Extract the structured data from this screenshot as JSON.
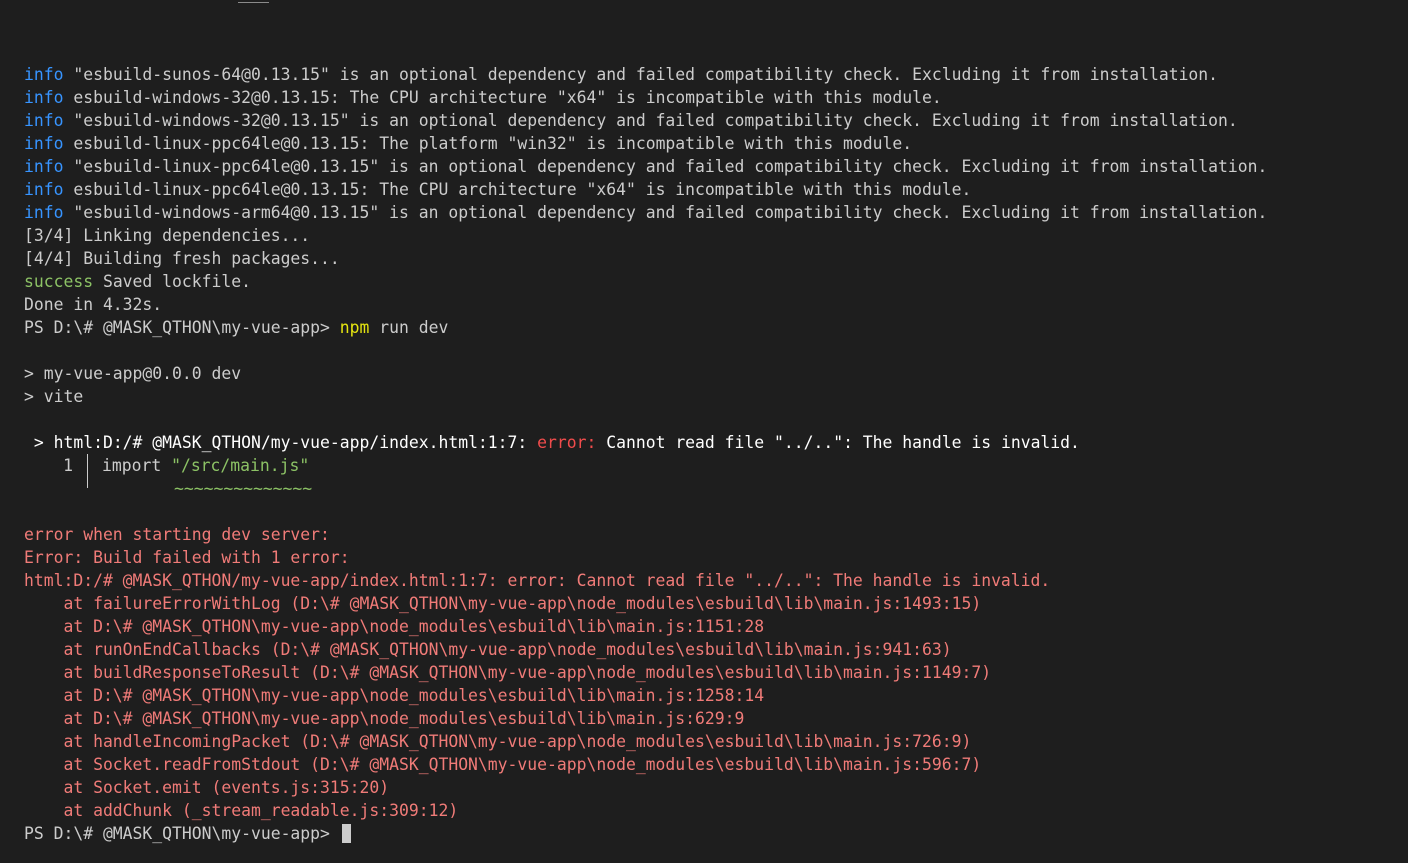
{
  "install_log": [
    {
      "level": "info",
      "text": " \"esbuild-sunos-64@0.13.15\" is an optional dependency and failed compatibility check. Excluding it from installation."
    },
    {
      "level": "info",
      "text": " esbuild-windows-32@0.13.15: The CPU architecture \"x64\" is incompatible with this module."
    },
    {
      "level": "info",
      "text": " \"esbuild-windows-32@0.13.15\" is an optional dependency and failed compatibility check. Excluding it from installation."
    },
    {
      "level": "info",
      "text": " esbuild-linux-ppc64le@0.13.15: The platform \"win32\" is incompatible with this module."
    },
    {
      "level": "info",
      "text": " \"esbuild-linux-ppc64le@0.13.15\" is an optional dependency and failed compatibility check. Excluding it from installation."
    },
    {
      "level": "info",
      "text": " esbuild-linux-ppc64le@0.13.15: The CPU architecture \"x64\" is incompatible with this module."
    },
    {
      "level": "info",
      "text": " \"esbuild-windows-arm64@0.13.15\" is an optional dependency and failed compatibility check. Excluding it from installation."
    }
  ],
  "steps": [
    "[3/4] Linking dependencies...",
    "[4/4] Building fresh packages..."
  ],
  "success": {
    "level": "success",
    "text": " Saved lockfile."
  },
  "done": "Done in 4.32s.",
  "prompt": "PS D:\\# @MASK_QTHON\\my-vue-app> ",
  "command": {
    "program": "npm",
    "args": " run dev"
  },
  "script_header": [
    "> my-vue-app@0.0.0 dev",
    "> vite"
  ],
  "esbuild_error": {
    "prefix": " > ",
    "location": "html:D:/# @MASK_QTHON/my-vue-app/index.html:1:7: ",
    "label": "error:",
    "message": " Cannot read file \"../..\": The handle is invalid.",
    "line_number": "1",
    "code_keyword": "import ",
    "code_string": "\"/src/main.js\"",
    "squiggle": "~~~~~~~~~~~~~~"
  },
  "error_trace": [
    "error when starting dev server:",
    "Error: Build failed with 1 error:",
    "html:D:/# @MASK_QTHON/my-vue-app/index.html:1:7: error: Cannot read file \"../..\": The handle is invalid.",
    "    at failureErrorWithLog (D:\\# @MASK_QTHON\\my-vue-app\\node_modules\\esbuild\\lib\\main.js:1493:15)",
    "    at D:\\# @MASK_QTHON\\my-vue-app\\node_modules\\esbuild\\lib\\main.js:1151:28",
    "    at runOnEndCallbacks (D:\\# @MASK_QTHON\\my-vue-app\\node_modules\\esbuild\\lib\\main.js:941:63)",
    "    at buildResponseToResult (D:\\# @MASK_QTHON\\my-vue-app\\node_modules\\esbuild\\lib\\main.js:1149:7)",
    "    at D:\\# @MASK_QTHON\\my-vue-app\\node_modules\\esbuild\\lib\\main.js:1258:14",
    "    at D:\\# @MASK_QTHON\\my-vue-app\\node_modules\\esbuild\\lib\\main.js:629:9",
    "    at handleIncomingPacket (D:\\# @MASK_QTHON\\my-vue-app\\node_modules\\esbuild\\lib\\main.js:726:9)",
    "    at Socket.readFromStdout (D:\\# @MASK_QTHON\\my-vue-app\\node_modules\\esbuild\\lib\\main.js:596:7)",
    "    at Socket.emit (events.js:315:20)",
    "    at addChunk (_stream_readable.js:309:12)"
  ],
  "final_prompt": "PS D:\\# @MASK_QTHON\\my-vue-app> ",
  "colors": {
    "background": "#1e1e1e",
    "foreground": "#cccccc",
    "info": "#3794ff",
    "success": "#8cc265",
    "error": "#f14c4c",
    "command": "#e5e510"
  }
}
